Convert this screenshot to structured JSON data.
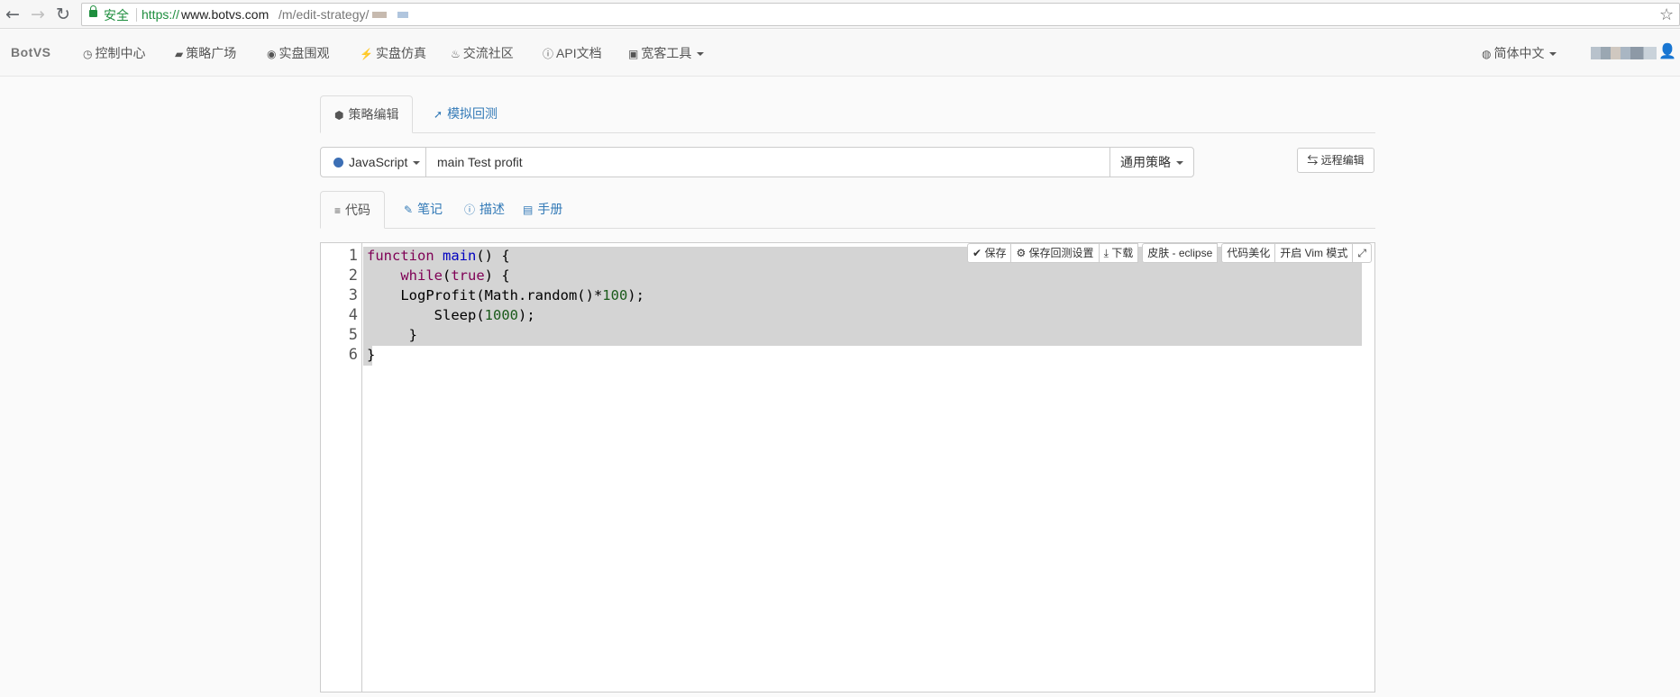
{
  "browser": {
    "secure_label": "安全",
    "url_scheme": "https://",
    "url_host": "www.botvs.com",
    "url_path": "/m/edit-strategy/"
  },
  "nav": {
    "brand": "BotVS",
    "items": [
      {
        "label": "控制中心",
        "icon": "dashboard-icon"
      },
      {
        "label": "策略广场",
        "icon": "cart-icon"
      },
      {
        "label": "实盘围观",
        "icon": "play-circle-icon"
      },
      {
        "label": "实盘仿真",
        "icon": "flash-icon"
      },
      {
        "label": "交流社区",
        "icon": "fire-icon"
      },
      {
        "label": "API文档",
        "icon": "info-icon"
      },
      {
        "label": "宽客工具",
        "icon": "briefcase-icon"
      }
    ],
    "language": "简体中文"
  },
  "tabs_top": [
    {
      "label": "策略编辑",
      "icon": "cubes-icon",
      "active": true
    },
    {
      "label": "模拟回测",
      "icon": "rocket-icon",
      "active": false
    }
  ],
  "strategy": {
    "language": "JavaScript",
    "name": "main Test profit",
    "type": "通用策略",
    "remote_edit": "远程编辑"
  },
  "tabs_sub": [
    {
      "label": "代码",
      "icon": "list-icon",
      "active": true
    },
    {
      "label": "笔记",
      "icon": "edit-icon",
      "active": false
    },
    {
      "label": "描述",
      "icon": "info-icon",
      "active": false
    },
    {
      "label": "手册",
      "icon": "book-icon",
      "active": false
    }
  ],
  "editor": {
    "toolbar": {
      "save": "保存",
      "save_backtest": "保存回测设置",
      "download": "下载",
      "skin": "皮肤 - eclipse",
      "beautify": "代码美化",
      "vim": "开启 Vim 模式"
    },
    "line_numbers": [
      "1",
      "2",
      "3",
      "4",
      "5",
      "6"
    ],
    "lines": [
      "function main() {",
      "    while(true) {",
      "    LogProfit(Math.random()*100);",
      "        Sleep(1000);",
      "     }",
      "}"
    ]
  }
}
